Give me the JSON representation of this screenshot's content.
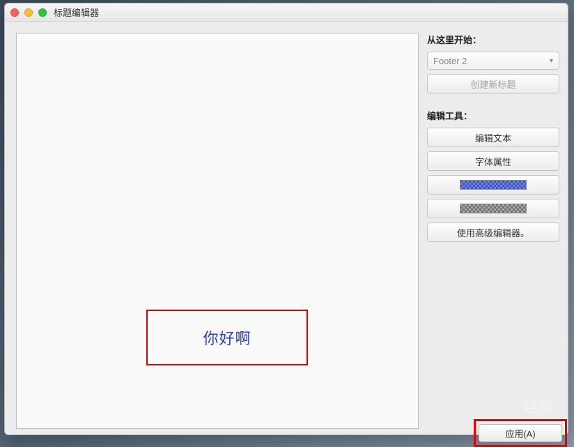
{
  "window": {
    "title": "标题编辑器"
  },
  "canvas": {
    "sample_text": "你好啊"
  },
  "sidebar": {
    "start_label": "从这里开始：",
    "select_value": "Footer 2",
    "create_button": "创建新标题",
    "tools_label": "编辑工具：",
    "edit_text_button": "编辑文本",
    "font_props_button": "字体属性",
    "advanced_editor_button": "使用高级编辑器。"
  },
  "footer": {
    "apply_button": "应用(A)"
  },
  "colors": {
    "swatch_blue": "#3f55c9",
    "swatch_gray": "#aaaaaa",
    "annotation_red": "#e30000"
  },
  "watermark": "经验"
}
